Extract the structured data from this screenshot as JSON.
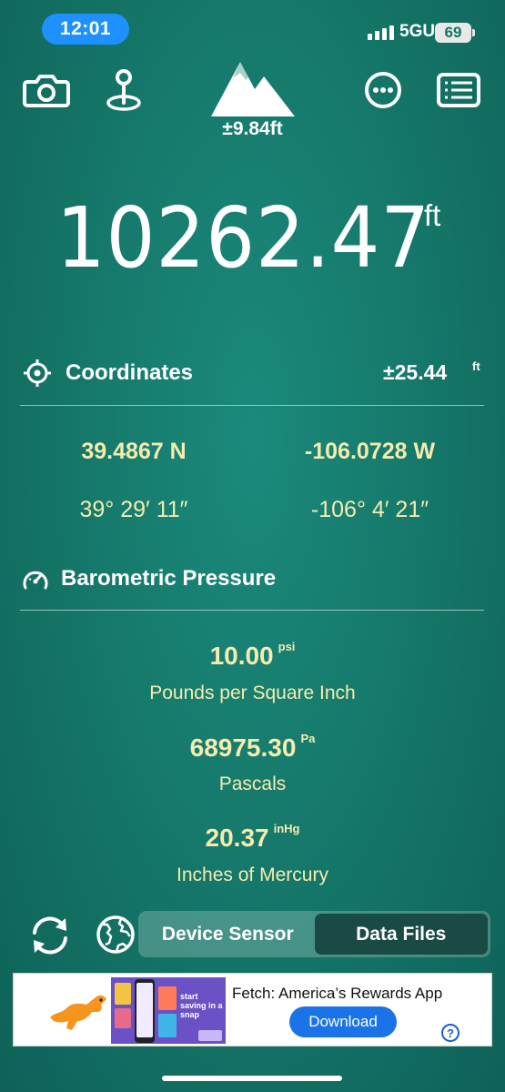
{
  "status_bar": {
    "time": "12:01",
    "network": "5GUC",
    "battery": "69"
  },
  "toolbar": {
    "accuracy": "±9.84ft",
    "icons": [
      "camera-icon",
      "map-pin-icon",
      "mountain-icon",
      "more-icon",
      "list-icon"
    ]
  },
  "elevation": {
    "value": "10262.47",
    "unit": "ft"
  },
  "coordinates": {
    "title": "Coordinates",
    "accuracy": "±25.44",
    "accuracy_unit": "ft",
    "lat_decimal": "39.4867 N",
    "lon_decimal": "-106.0728 W",
    "lat_dms": "39° 29′ 11″",
    "lon_dms": "-106° 4′ 21″"
  },
  "barometric": {
    "title": "Barometric Pressure",
    "psi_value": "10.00",
    "psi_unit": "psi",
    "psi_name": "Pounds per Square Inch",
    "pa_value": "68975.30",
    "pa_unit": "Pa",
    "pa_name": "Pascals",
    "hg_value": "20.37",
    "hg_unit": "inHg",
    "hg_name": "Inches of Mercury"
  },
  "source_toggle": {
    "options": [
      "Device Sensor",
      "Data Files"
    ],
    "selected": "Data Files"
  },
  "ad": {
    "title": "Fetch: America’s Rewards App",
    "button": "Download",
    "image_text": "start saving in a snap",
    "help": "?"
  },
  "colors": {
    "background": "#147567",
    "value_yellow": "#f6ecae",
    "selected_segment": "#194a43",
    "time_pill": "#1e90ff"
  }
}
